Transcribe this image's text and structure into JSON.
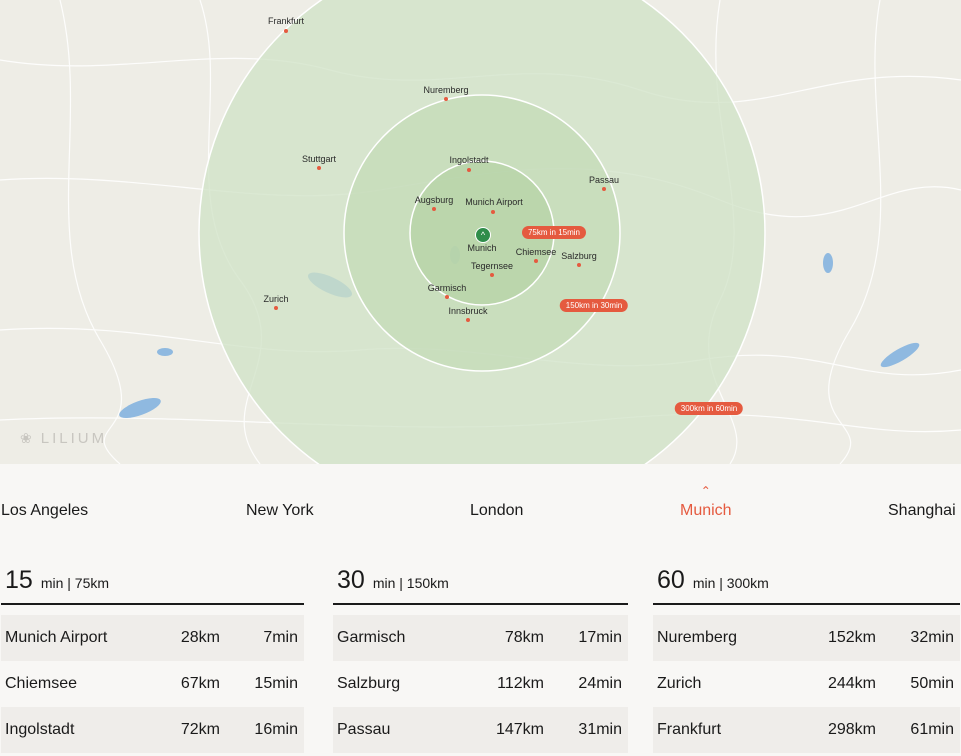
{
  "map": {
    "logo_text": "LILIUM",
    "hub_label": "Munich",
    "cities": [
      {
        "name": "Frankfurt"
      },
      {
        "name": "Nuremberg"
      },
      {
        "name": "Stuttgart"
      },
      {
        "name": "Ingolstadt"
      },
      {
        "name": "Passau"
      },
      {
        "name": "Augsburg"
      },
      {
        "name": "Munich Airport"
      },
      {
        "name": "Chiemsee"
      },
      {
        "name": "Salzburg"
      },
      {
        "name": "Tegernsee"
      },
      {
        "name": "Garmisch"
      },
      {
        "name": "Innsbruck"
      },
      {
        "name": "Zurich"
      }
    ],
    "range_pills": [
      "75km in 15min",
      "150km in 30min",
      "300km in 60min"
    ],
    "colors": {
      "ring_fill": "#cfe2c6",
      "pill": "#e55a3f",
      "hub": "#2f8d4a"
    }
  },
  "tabs": [
    {
      "label": "Los Angeles",
      "active": false
    },
    {
      "label": "New York",
      "active": false
    },
    {
      "label": "London",
      "active": false
    },
    {
      "label": "Munich",
      "active": true
    },
    {
      "label": "Shanghai",
      "active": false
    }
  ],
  "columns": [
    {
      "big": "15",
      "small": "min | 75km",
      "rows": [
        {
          "name": "Munich Airport",
          "km": "28km",
          "min": "7min"
        },
        {
          "name": "Chiemsee",
          "km": "67km",
          "min": "15min"
        },
        {
          "name": "Ingolstadt",
          "km": "72km",
          "min": "16min"
        }
      ]
    },
    {
      "big": "30",
      "small": "min | 150km",
      "rows": [
        {
          "name": "Garmisch",
          "km": "78km",
          "min": "17min"
        },
        {
          "name": "Salzburg",
          "km": "112km",
          "min": "24min"
        },
        {
          "name": "Passau",
          "km": "147km",
          "min": "31min"
        }
      ]
    },
    {
      "big": "60",
      "small": "min | 300km",
      "rows": [
        {
          "name": "Nuremberg",
          "km": "152km",
          "min": "32min"
        },
        {
          "name": "Zurich",
          "km": "244km",
          "min": "50min"
        },
        {
          "name": "Frankfurt",
          "km": "298km",
          "min": "61min"
        }
      ]
    }
  ]
}
